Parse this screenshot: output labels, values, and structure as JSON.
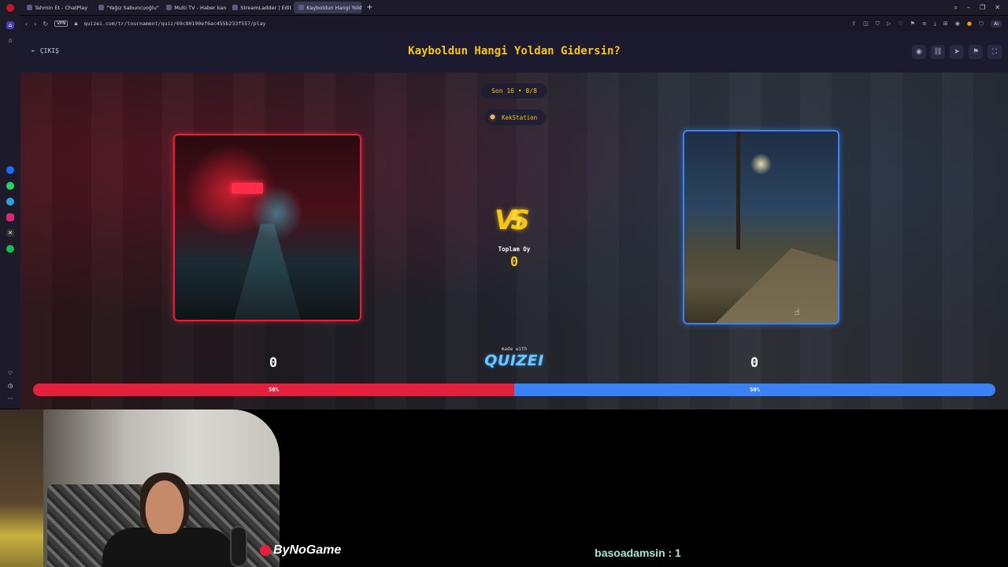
{
  "browser": {
    "tabs": [
      {
        "label": "Tahmin Et - ChatPlay",
        "active": false
      },
      {
        "label": "\"Yağız Sabuncuoğlu\" - Ar",
        "active": false
      },
      {
        "label": "Multi TV - Haber kanalları",
        "active": false
      },
      {
        "label": "StreamLadder | Edit Twitc",
        "active": false
      },
      {
        "label": "Kayboldun Hangi Yoldan",
        "active": true
      }
    ],
    "vpn_label": "VPN",
    "url": "quizei.com/tr/tournament/quiz/69c80190ef6ac455b233f557/play",
    "ai_label": "AI"
  },
  "header": {
    "exit_label": "ÇIKIŞ",
    "title": "Kayboldun Hangi Yoldan Gidersin?"
  },
  "round": {
    "label": "Son 16 • 8/8"
  },
  "creator": {
    "name": "KekStation"
  },
  "vs": {
    "label": "VS",
    "total_label": "Toplam Oy",
    "total_value": "0"
  },
  "left_choice": {
    "votes": "0",
    "percent_label": "50%",
    "percent": 50,
    "color": "#e5203c"
  },
  "right_choice": {
    "votes": "0",
    "percent_label": "50%",
    "percent": 50,
    "color": "#3b82f6"
  },
  "branding": {
    "made_with": "made with",
    "brand": "QUIZEI"
  },
  "stream_overlay": {
    "sponsor": "ByNoGame",
    "chat_vote": "basoadamsin : 1"
  },
  "colors": {
    "accent": "#f5c518",
    "header_bg": "#1c1a2e"
  }
}
